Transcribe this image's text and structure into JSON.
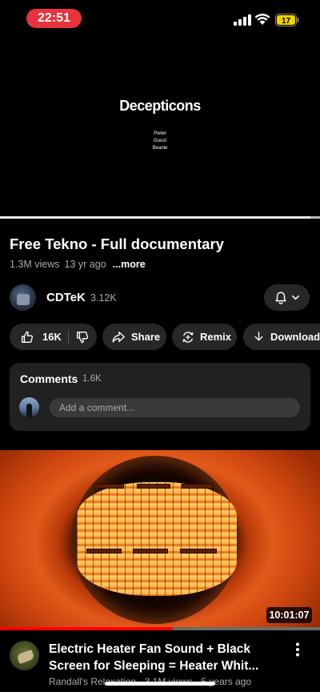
{
  "status_bar": {
    "time": "22:51",
    "battery_level": "17",
    "battery_color": "#f2d100",
    "icons": [
      "signal-icon",
      "wifi-icon",
      "battery-icon"
    ]
  },
  "player": {
    "video_text_title": "Decepticons",
    "video_text_credits": [
      "Pieter",
      "Guust",
      "Beanie"
    ],
    "progress": 0.97
  },
  "video": {
    "title": "Free Tekno - Full documentary",
    "views": "1.3M views",
    "age": "13 yr ago",
    "more_label": "...more"
  },
  "channel": {
    "name": "CDTeK",
    "subscribers": "3.12K"
  },
  "actions": {
    "like_count": "16K",
    "share_label": "Share",
    "remix_label": "Remix",
    "download_label": "Download"
  },
  "comments": {
    "label": "Comments",
    "count": "1.6K",
    "placeholder": "Add a comment..."
  },
  "next_video": {
    "duration": "10:01:07",
    "watch_progress": 0.54,
    "title": "Electric Heater Fan Sound + Black Screen for Sleeping = Heater Whit...",
    "channel": "Randall's Relaxation",
    "views": "3.1M views",
    "age": "5 years ago"
  },
  "colors": {
    "accent_red": "#ff0000",
    "pill_bg": "#272727",
    "card_bg": "#212121"
  }
}
